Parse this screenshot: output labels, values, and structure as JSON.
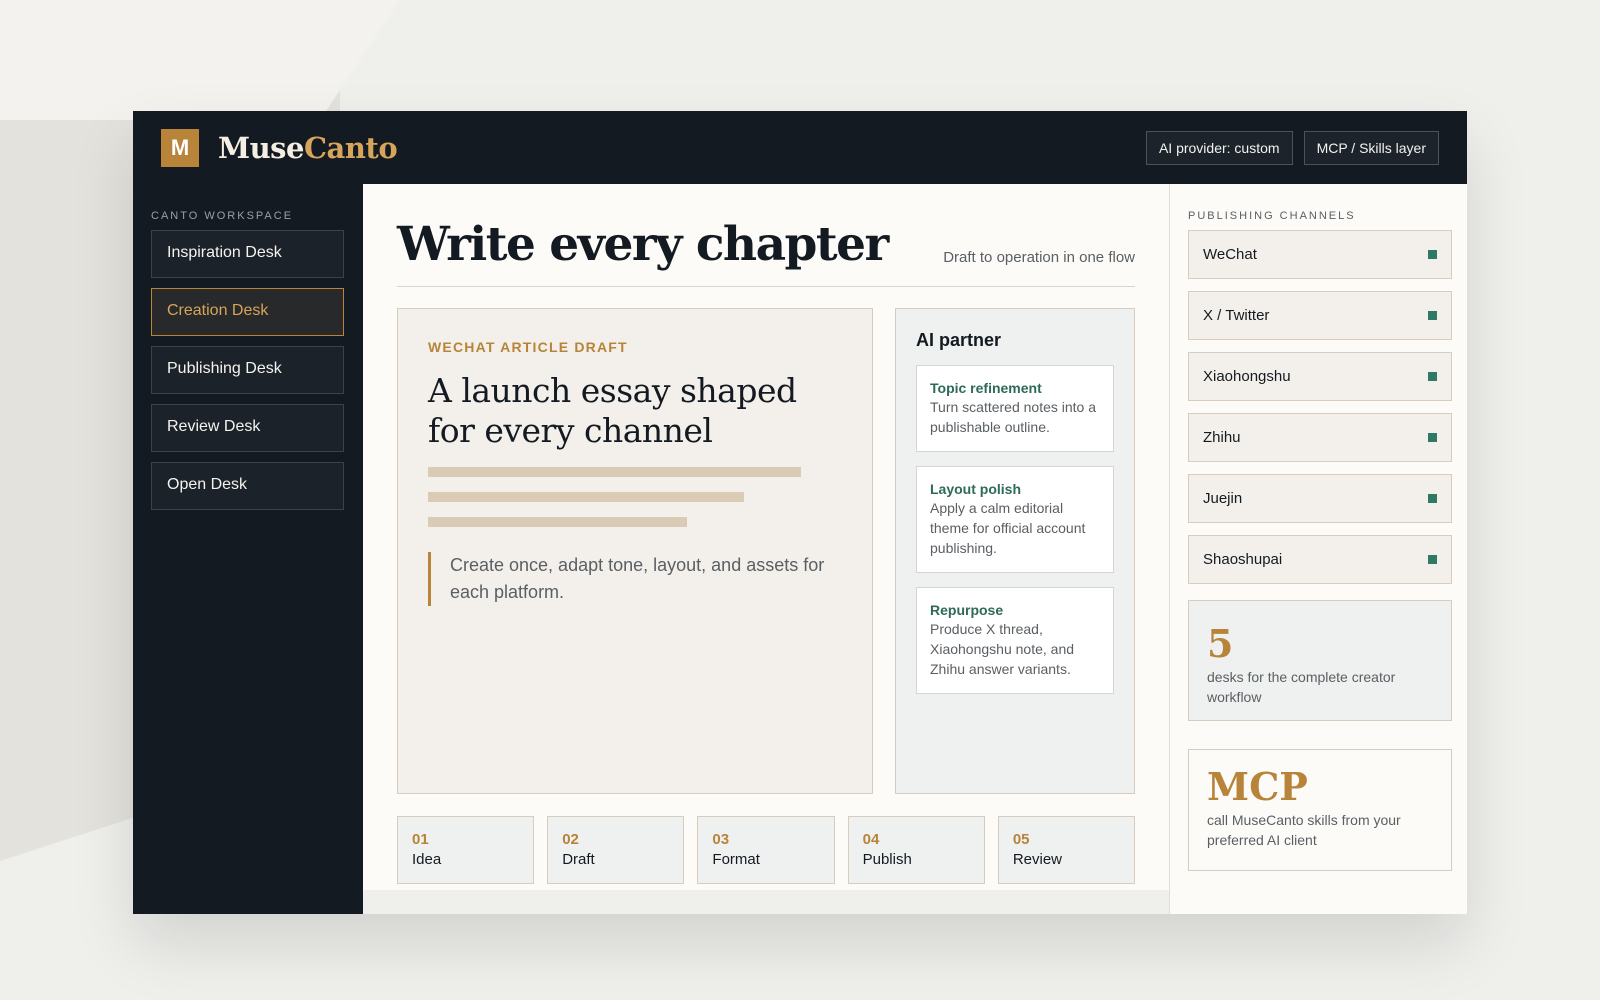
{
  "app": {
    "logo_letter": "M",
    "brand_part1": "Muse",
    "brand_part2": "Canto",
    "accent": "#b7843a",
    "dark": "#141a21"
  },
  "topbar": {
    "ai_provider_label": "AI provider: custom",
    "mcp_label": "MCP / Skills layer"
  },
  "sidebar": {
    "title": "CANTO WORKSPACE",
    "items": [
      {
        "label": "Inspiration Desk",
        "active": false
      },
      {
        "label": "Creation Desk",
        "active": true
      },
      {
        "label": "Publishing Desk",
        "active": false
      },
      {
        "label": "Review Desk",
        "active": false
      },
      {
        "label": "Open Desk",
        "active": false
      }
    ]
  },
  "main": {
    "title": "Write every chapter",
    "subtitle": "Draft to operation in one flow",
    "draft": {
      "kicker": "WECHAT ARTICLE DRAFT",
      "title": "A launch essay shaped for every channel",
      "quote": "Create once, adapt tone, layout, and assets for each platform."
    },
    "ai_partner": {
      "title": "AI partner",
      "items": [
        {
          "title": "Topic refinement",
          "text": "Turn scattered notes into a publishable outline."
        },
        {
          "title": "Layout polish",
          "text": "Apply a calm editorial theme for official account publishing."
        },
        {
          "title": "Repurpose",
          "text": "Produce X thread, Xiaohongshu note, and Zhihu answer variants."
        }
      ]
    },
    "steps": [
      {
        "num": "01",
        "label": "Idea"
      },
      {
        "num": "02",
        "label": "Draft"
      },
      {
        "num": "03",
        "label": "Format"
      },
      {
        "num": "04",
        "label": "Publish"
      },
      {
        "num": "05",
        "label": "Review"
      }
    ]
  },
  "right": {
    "title": "PUBLISHING CHANNELS",
    "channels": [
      "WeChat",
      "X / Twitter",
      "Xiaohongshu",
      "Zhihu",
      "Juejin",
      "Shaoshupai"
    ],
    "status_color": "#2e7a64",
    "stat": {
      "value": "5",
      "text": "desks for the complete creator workflow"
    },
    "mcp": {
      "value": "MCP",
      "text": "call MuseCanto skills from your preferred AI client"
    }
  }
}
